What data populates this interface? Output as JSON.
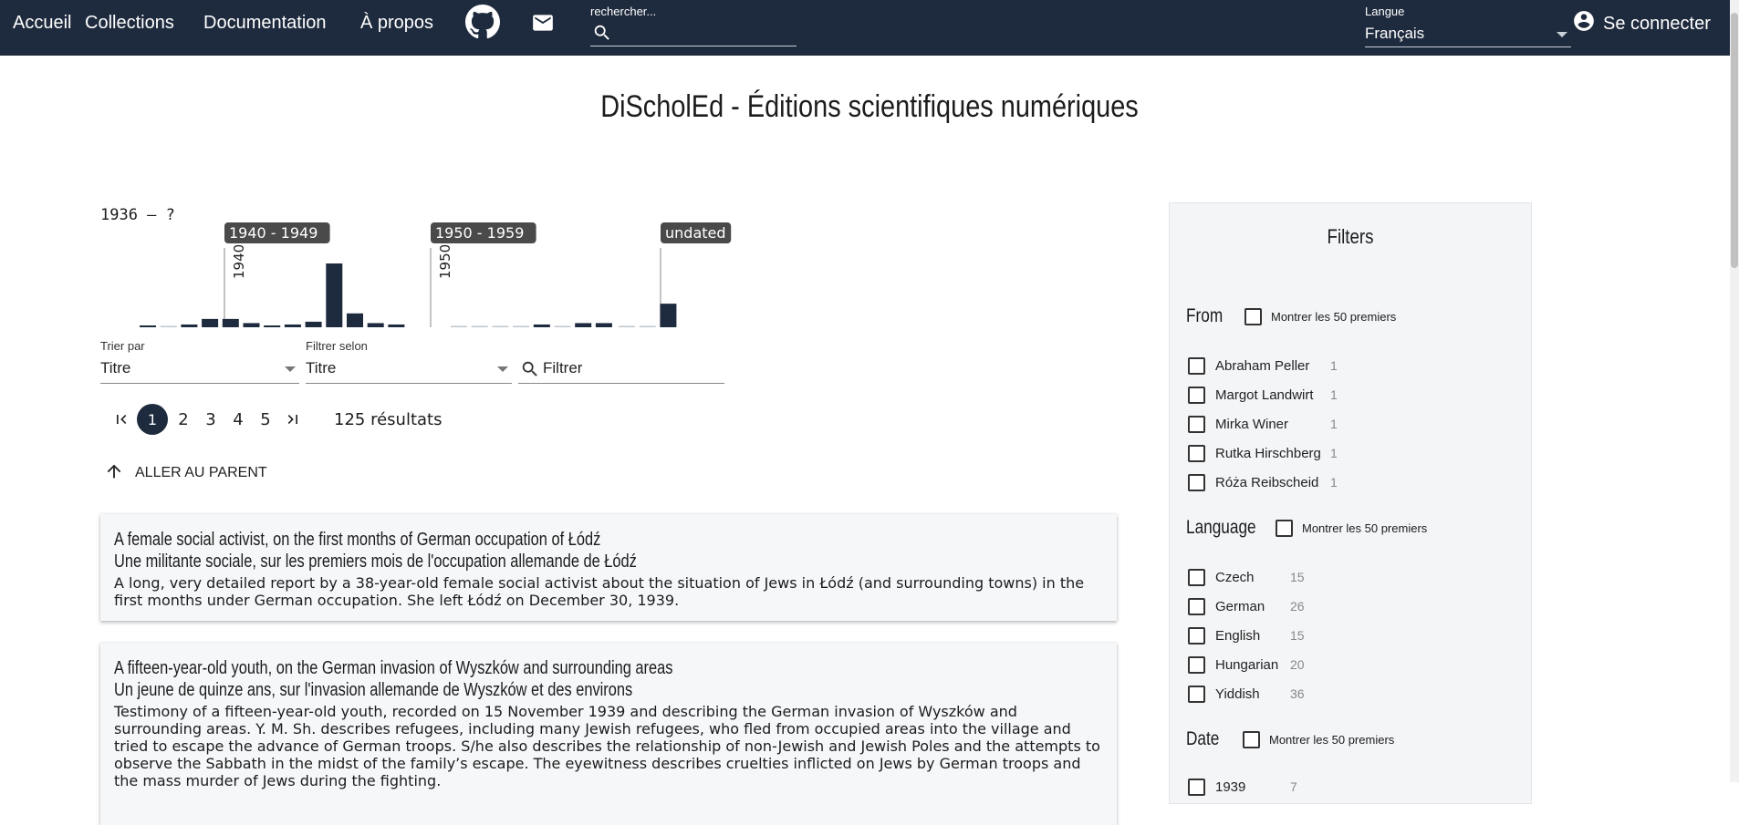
{
  "nav": {
    "home": "Accueil",
    "collections": "Collections",
    "documentation": "Documentation",
    "about": "À propos",
    "github_icon": "github-icon",
    "mail_icon": "mail-icon"
  },
  "search": {
    "placeholder": "rechercher..."
  },
  "language": {
    "label": "Langue",
    "value": "Français"
  },
  "login": {
    "label": "Se connecter"
  },
  "page": {
    "title": "DiScholEd - Éditions scientifiques numériques"
  },
  "timeline": {
    "range_label": "1936 – ?",
    "groups": [
      {
        "label": "1940 - 1949",
        "marker": "1940"
      },
      {
        "label": "1950 - 1959",
        "marker": "1950"
      },
      {
        "label": "undated",
        "marker": ""
      }
    ],
    "bars": [
      {
        "group": 0,
        "value": 1
      },
      {
        "group": 0,
        "value": 0
      },
      {
        "group": 0,
        "value": 2
      },
      {
        "group": 0,
        "value": 6
      },
      {
        "group": 0,
        "value": 6
      },
      {
        "group": 0,
        "value": 3
      },
      {
        "group": 0,
        "value": 1
      },
      {
        "group": 0,
        "value": 2
      },
      {
        "group": 0,
        "value": 4
      },
      {
        "group": 0,
        "value": 46
      },
      {
        "group": 0,
        "value": 10
      },
      {
        "group": 0,
        "value": 3
      },
      {
        "group": 0,
        "value": 2
      },
      {
        "group": 1,
        "value": 0
      },
      {
        "group": 1,
        "value": 0
      },
      {
        "group": 1,
        "value": 0
      },
      {
        "group": 1,
        "value": 0
      },
      {
        "group": 1,
        "value": 2
      },
      {
        "group": 1,
        "value": 0
      },
      {
        "group": 1,
        "value": 3
      },
      {
        "group": 1,
        "value": 3
      },
      {
        "group": 2,
        "value": 0
      },
      {
        "group": 2,
        "value": 0
      },
      {
        "group": 2,
        "value": 17
      }
    ]
  },
  "sort": {
    "label": "Trier par",
    "value": "Titre"
  },
  "filter_by": {
    "label": "Filtrer selon",
    "value": "Titre"
  },
  "filter": {
    "placeholder": "Filtrer"
  },
  "pagination": {
    "first_icon": "first-page-icon",
    "pages": [
      "1",
      "2",
      "3",
      "4",
      "5"
    ],
    "current": "1",
    "last_icon": "last-page-icon",
    "results": "125 résultats"
  },
  "parent": {
    "label": "ALLER AU PARENT"
  },
  "results": [
    {
      "title_en": "A female social activist, on the first months of German occupation of Łódź",
      "title_fr": "Une militante sociale, sur les premiers mois de l'occupation allemande de Łódź",
      "description": "A long, very detailed report by a 38-year-old female social activist about the situation of Jews in Łódź (and surrounding towns) in the first months under German occupation. She left Łódź on December 30, 1939."
    },
    {
      "title_en": "A fifteen-year-old youth, on the German invasion of Wyszków and surrounding areas",
      "title_fr": "Un jeune de quinze ans, sur l'invasion allemande de Wyszków et des environs",
      "description": "Testimony of a fifteen-year-old youth, recorded on 15 November 1939 and describing the German invasion of Wyszków and surrounding areas. Y. M. Sh. describes refugees, including many Jewish refugees, who fled from occupied areas into the village and tried to escape the advance of German troops. S/he also describes the relationship of non-Jewish and Jewish Poles and the attempts to observe the Sabbath in the midst of the family’s escape. The eyewitness describes cruelties inflicted on Jews by German troops and the mass murder of Jews during the fighting."
    }
  ],
  "filters": {
    "title": "Filters",
    "top_label": "Montrer les 50 premiers",
    "facets": [
      {
        "name": "From",
        "items": [
          {
            "label": "Abraham Peller",
            "count": "1"
          },
          {
            "label": "Margot Landwirt",
            "count": "1"
          },
          {
            "label": "Mirka Winer",
            "count": "1"
          },
          {
            "label": "Rutka Hirschberg",
            "count": "1"
          },
          {
            "label": "Róża Reibscheid",
            "count": "1"
          }
        ]
      },
      {
        "name": "Language",
        "items": [
          {
            "label": "Czech",
            "count": "15"
          },
          {
            "label": "German",
            "count": "26"
          },
          {
            "label": "English",
            "count": "15"
          },
          {
            "label": "Hungarian",
            "count": "20"
          },
          {
            "label": "Yiddish",
            "count": "36"
          }
        ]
      },
      {
        "name": "Date",
        "items": [
          {
            "label": "1939",
            "count": "7"
          }
        ]
      }
    ]
  },
  "colors": {
    "topbar": "#1e2a3d",
    "bar": "#1e2a3d",
    "sidebar": "#f4f5f7"
  }
}
